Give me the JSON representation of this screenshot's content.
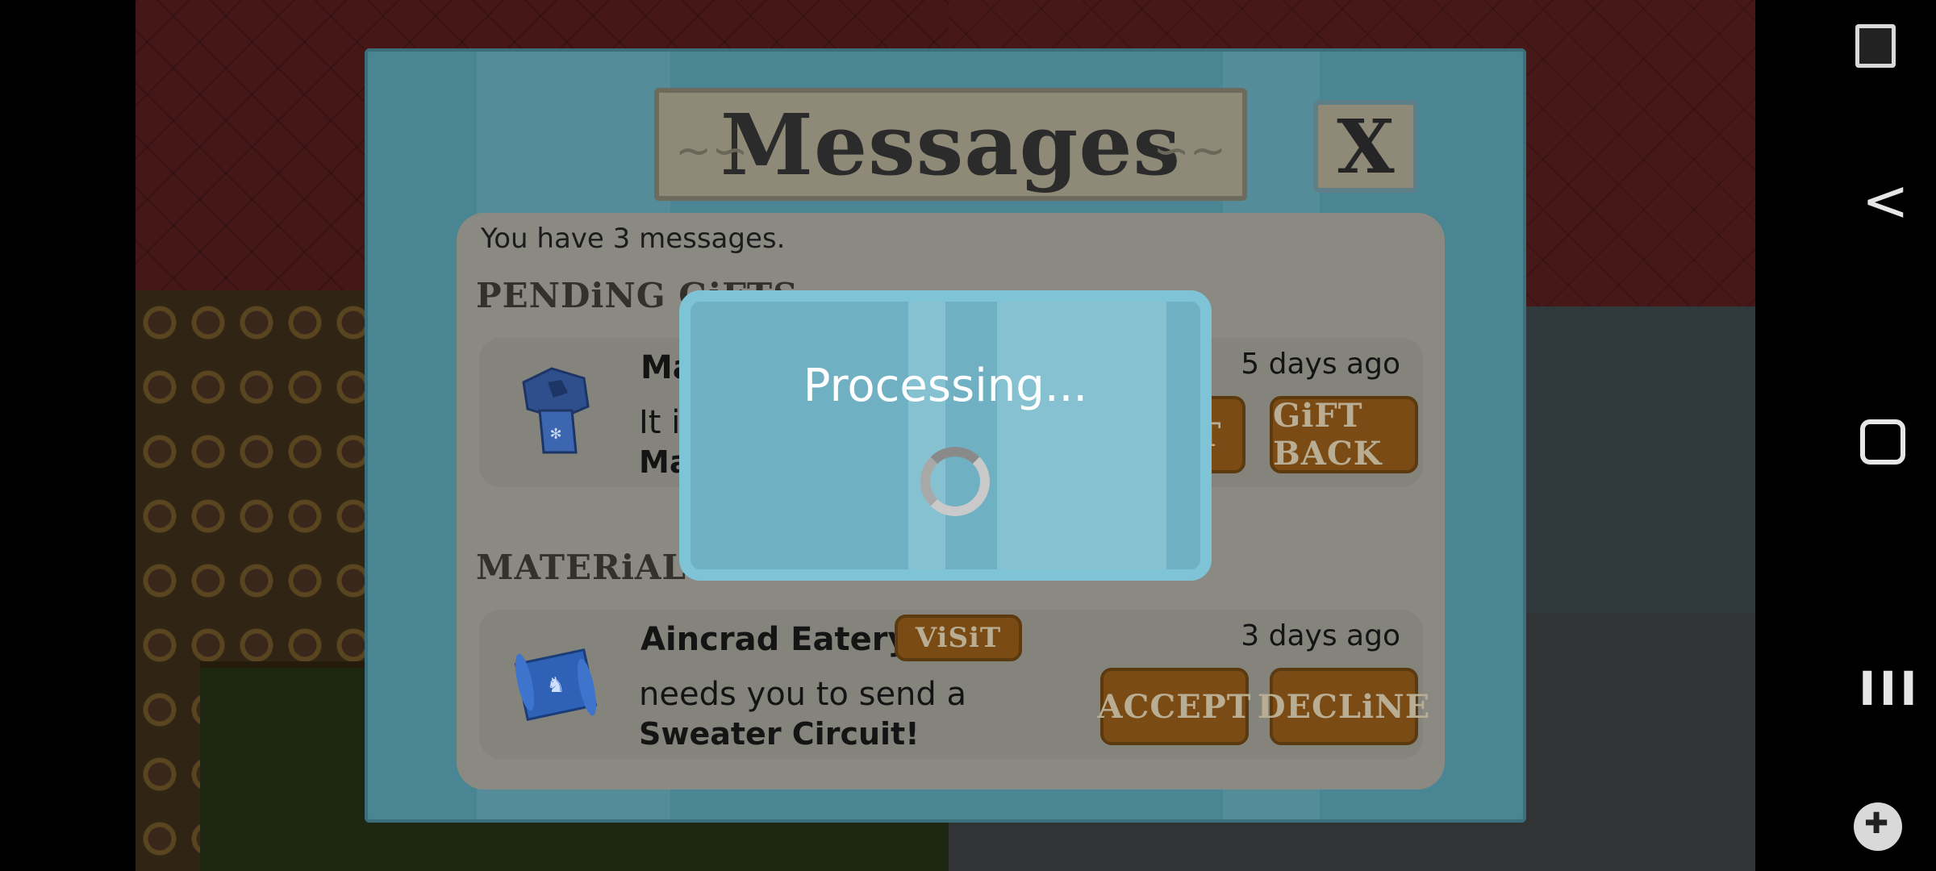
{
  "dialog": {
    "title": "Messages",
    "close_label": "X",
    "message_count": "You have 3 messages.",
    "sections": {
      "pending_gifts": "PENDiNG GiFTS",
      "materials_requested": "MATERiALS RE"
    },
    "gift_row": {
      "sender": "Ma",
      "line1": "It i",
      "line2": "Ma",
      "time": "5 days ago",
      "partial_button": "T",
      "gift_back_label": "GiFT BACK",
      "icon": "blue-bolt-icon"
    },
    "request_row": {
      "sender": "Aincrad Eatery",
      "visit_label": "ViSiT",
      "line1": "needs you to send a",
      "line2": "Sweater Circuit!",
      "time": "3 days ago",
      "accept_label": "ACCEPT",
      "decline_label": "DECLiNE",
      "icon": "blue-scroll-icon"
    }
  },
  "processing": {
    "text": "Processing..."
  },
  "nav": {
    "back_glyph": "<",
    "recent_glyph": "III"
  },
  "colors": {
    "accent_button": "#7a4b14",
    "dialog_bg": "#4a8593",
    "popup_bg": "#6fb0c3"
  }
}
